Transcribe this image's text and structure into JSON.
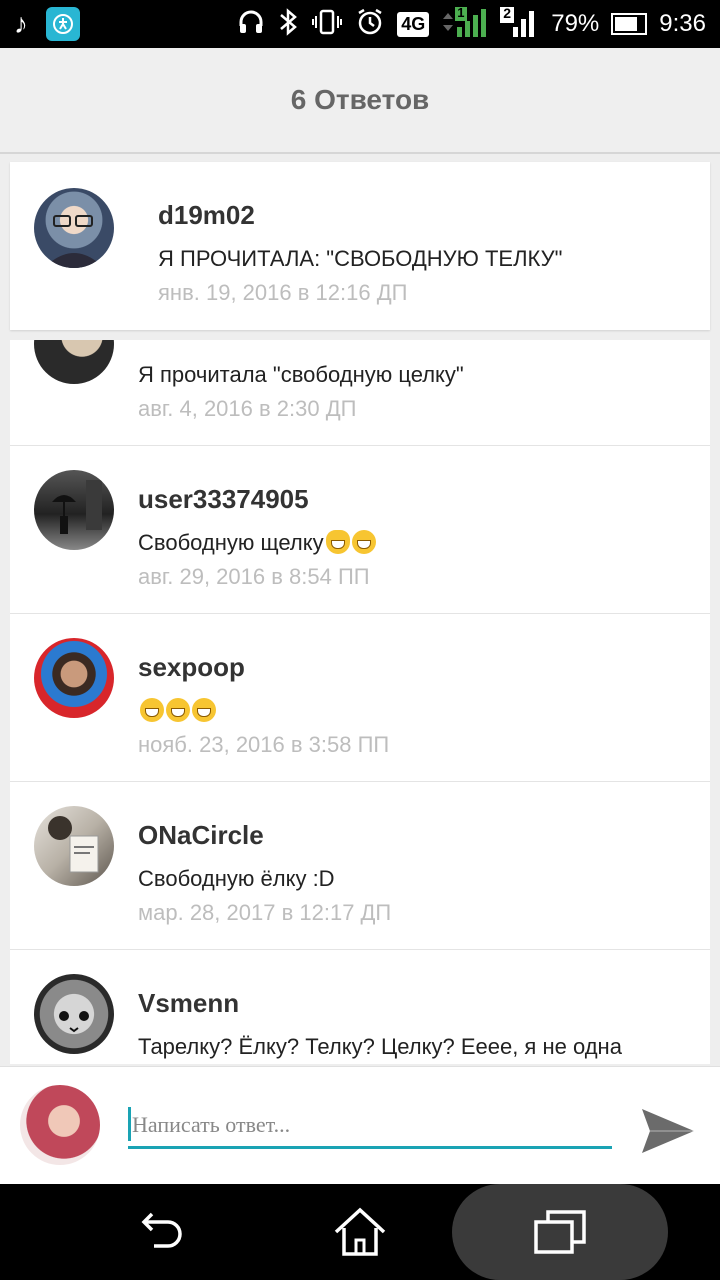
{
  "status_bar": {
    "network": "4G",
    "sim_slot": "2",
    "sim_main": "1",
    "battery_percent": "79%",
    "time": "9:36",
    "battery_level": 0.79
  },
  "header": {
    "title": "6 Ответов"
  },
  "pinned": {
    "username": "d19m02",
    "message": "Я ПРОЧИТАЛА: \"СВОБОДНУЮ ТЕЛКУ\"",
    "timestamp": "янв. 19, 2016 в 12:16 ДП"
  },
  "replies": [
    {
      "username": "",
      "message": "Я прочитала \"свободную целку\"",
      "timestamp": "авг. 4, 2016 в 2:30 ДП"
    },
    {
      "username": "user33374905",
      "message": "Свободную щелку",
      "timestamp": "авг. 29, 2016 в 8:54 ПП"
    },
    {
      "username": "sexpoop",
      "message": "",
      "timestamp": "нояб. 23, 2016 в 3:58 ПП"
    },
    {
      "username": "ONaCircle",
      "message": "Свободную ёлку :D",
      "timestamp": "мар. 28, 2017 в 12:17 ДП"
    },
    {
      "username": "Vsmenn",
      "message": "Тарелку? Ёлку? Телку? Целку? Ееее, я не одна",
      "timestamp": ""
    }
  ],
  "composer": {
    "placeholder": "Написать ответ..."
  },
  "colors": {
    "accent": "#1aa3b4",
    "timestamp": "#bdbdbd",
    "header_bg": "#efefef"
  }
}
